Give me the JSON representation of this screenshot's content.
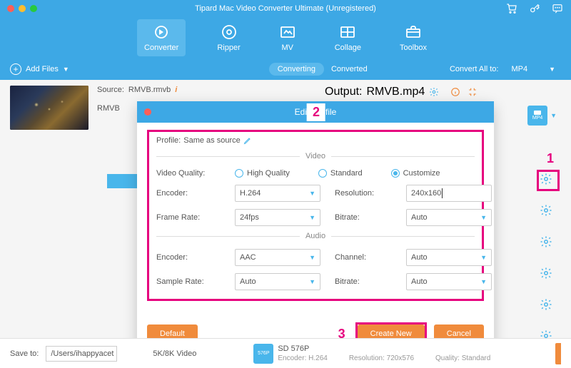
{
  "titlebar": {
    "title": "Tipard Mac Video Converter Ultimate (Unregistered)"
  },
  "nav": {
    "items": [
      {
        "label": "Converter"
      },
      {
        "label": "Ripper"
      },
      {
        "label": "MV"
      },
      {
        "label": "Collage"
      },
      {
        "label": "Toolbox"
      }
    ]
  },
  "toolbar": {
    "add_files": "Add Files",
    "tabs": {
      "converting": "Converting",
      "converted": "Converted"
    },
    "convert_all_label": "Convert All to:",
    "convert_all_value": "MP4"
  },
  "file": {
    "source_label": "Source:",
    "source_value": "RMVB.rmvb",
    "output_label": "Output:",
    "output_value": "RMVB.mp4",
    "name": "RMVB",
    "format_badge": "MP4"
  },
  "modal": {
    "title_pre": "Edi",
    "title_post": "file",
    "profile_label": "Profile:",
    "profile_value": "Same as source",
    "section_video": "Video",
    "section_audio": "Audio",
    "video": {
      "quality_label": "Video Quality:",
      "opt_high": "High Quality",
      "opt_std": "Standard",
      "opt_custom": "Customize",
      "encoder_label": "Encoder:",
      "encoder_value": "H.264",
      "resolution_label": "Resolution:",
      "resolution_value": "240x160",
      "framerate_label": "Frame Rate:",
      "framerate_value": "24fps",
      "bitrate_label": "Bitrate:",
      "bitrate_value": "Auto"
    },
    "audio": {
      "encoder_label": "Encoder:",
      "encoder_value": "AAC",
      "channel_label": "Channel:",
      "channel_value": "Auto",
      "samplerate_label": "Sample Rate:",
      "samplerate_value": "Auto",
      "bitrate_label": "Bitrate:",
      "bitrate_value": "Auto"
    },
    "buttons": {
      "default": "Default",
      "create_new": "Create New",
      "cancel": "Cancel"
    }
  },
  "annotations": {
    "n1": "1",
    "n2": "2",
    "n3": "3"
  },
  "save": {
    "label": "Save to:",
    "path": "/Users/ihappyacet",
    "side_label": "5K/8K Video",
    "preset_name": "SD 576P",
    "preset_encoder_label": "Encoder:",
    "preset_encoder": "H.264",
    "preset_res_label": "Resolution:",
    "preset_res": "720x576",
    "preset_quality_label": "Quality:",
    "preset_quality": "Standard"
  }
}
